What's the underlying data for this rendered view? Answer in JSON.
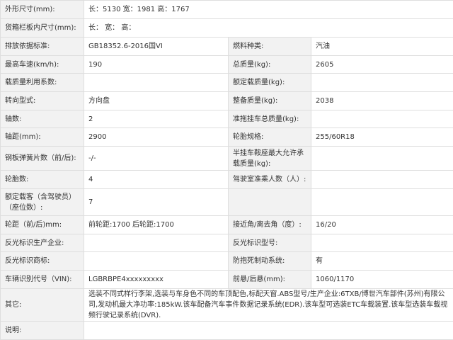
{
  "rows": [
    {
      "h": 26,
      "label": "外形尺寸(mm):",
      "full": "长：5130 宽：1981 高：1767"
    },
    {
      "h": 26,
      "label": "货箱栏板内尺寸(mm):",
      "full": "长：  宽：  高："
    },
    {
      "h": 26,
      "l1": "排放依据标准:",
      "v1": "GB18352.6-2016国VI",
      "l2": "燃料种类:",
      "v2": "汽油"
    },
    {
      "h": 25,
      "l1": "最高车速(km/h):",
      "v1": "190",
      "l2": "总质量(kg):",
      "v2": "2605"
    },
    {
      "h": 26,
      "l1": "载质量利用系数:",
      "v1": "",
      "l2": "额定载质量(kg):",
      "v2": ""
    },
    {
      "h": 26,
      "l1": "转向型式:",
      "v1": "方向盘",
      "l2": "整备质量(kg):",
      "v2": "2038"
    },
    {
      "h": 25,
      "l1": "轴数:",
      "v1": "2",
      "l2": "准拖挂车总质量(kg):",
      "v2": ""
    },
    {
      "h": 26,
      "l1": "轴距(mm):",
      "v1": "2900",
      "l2": "轮胎规格:",
      "v2": "255/60R18"
    },
    {
      "h": 34,
      "l1": "钢板弹簧片数（前/后):",
      "v1": "-/-",
      "l2": "半挂车鞍座最大允许承载质量(kg):",
      "v2": ""
    },
    {
      "h": 26,
      "l1": "轮胎数:",
      "v1": "4",
      "l2": "驾驶室准乘人数（人）:",
      "v2": ""
    },
    {
      "h": 38,
      "l1": "额定载客（含驾驶员）（座位数）:",
      "v1": "7",
      "l2": "",
      "v2": ""
    },
    {
      "h": 26,
      "l1": "轮距（前/后)mm:",
      "v1": "前轮距:1700 后轮距:1700",
      "l2": "接近角/离去角（度）:",
      "v2": "16/20"
    },
    {
      "h": 25,
      "l1": "反光标识生产企业:",
      "v1": "",
      "l2": "反光标识型号:",
      "v2": ""
    },
    {
      "h": 26,
      "l1": "反光标识商标:",
      "v1": "",
      "l2": "防抱死制动系统:",
      "v2": "有"
    },
    {
      "h": 26,
      "l1": "车辆识别代号（VIN):",
      "v1": "LGBRBPE4xxxxxxxxx",
      "l2": "前悬/后悬(mm):",
      "v2": "1060/1170"
    },
    {
      "h": 46,
      "label": "其它:",
      "full": "选装不同式样行李架,选装与车身色不同的车顶配色,标配天窗.ABS型号/生产企业:6TXB/博世汽车部件(苏州)有限公司,发动机最大净功率:185kW.该车配备汽车事件数据记录系统(EDR).该车型可选装ETC车载装置.该车型选装车载视频行驶记录系统(DVR)."
    },
    {
      "h": 26,
      "label": "说明:",
      "full": ""
    }
  ]
}
